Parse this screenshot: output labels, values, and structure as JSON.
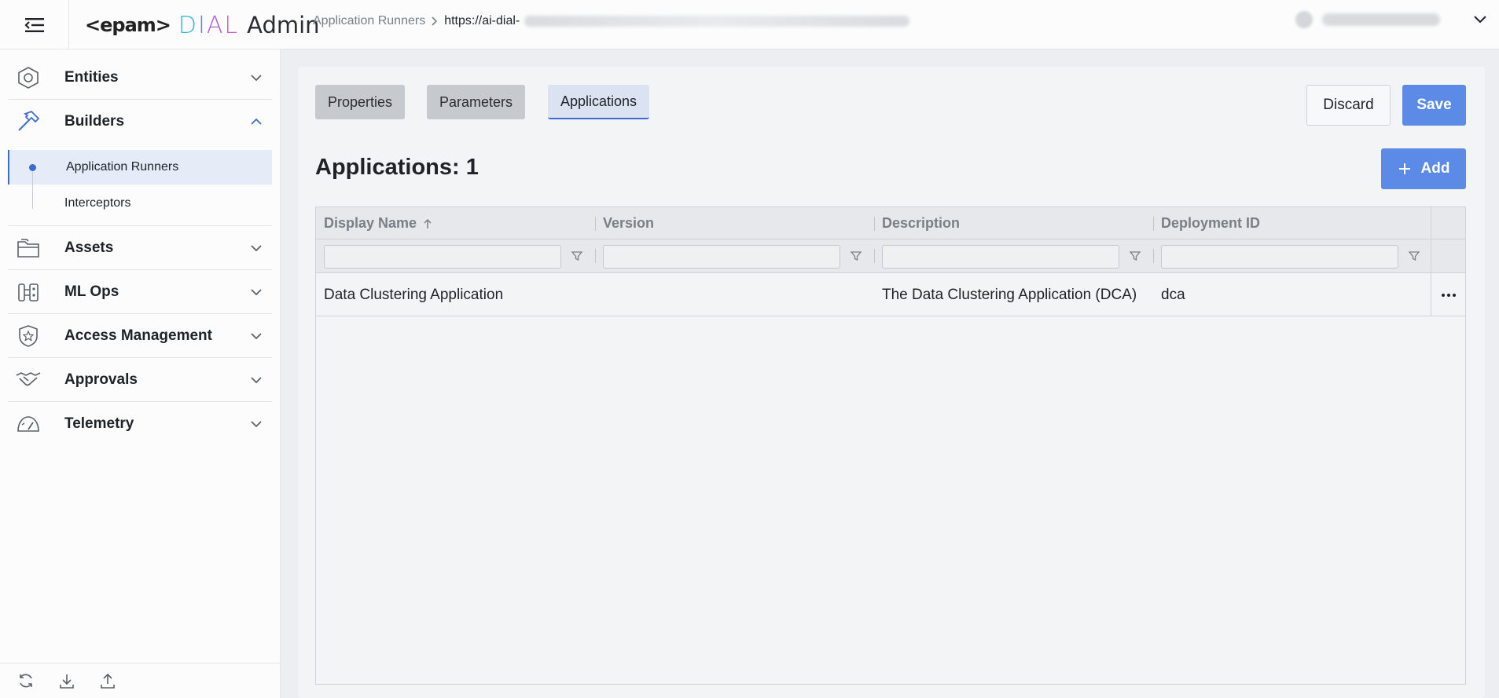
{
  "header": {
    "logo_epam": "<epam>",
    "logo_dial": [
      "D",
      "I",
      "A",
      "L"
    ],
    "logo_admin": "Admin",
    "breadcrumb": {
      "parent": "Application Runners",
      "current_url": "https://ai-dial-"
    }
  },
  "sidebar": {
    "items": [
      {
        "label": "Entities",
        "icon": "hexagon-icon"
      },
      {
        "label": "Builders",
        "icon": "hammer-icon",
        "expanded": true,
        "children": [
          {
            "label": "Application Runners",
            "active": true
          },
          {
            "label": "Interceptors"
          }
        ]
      },
      {
        "label": "Assets",
        "icon": "folder-icon"
      },
      {
        "label": "ML Ops",
        "icon": "mlops-icon"
      },
      {
        "label": "Access Management",
        "icon": "shield-star-icon"
      },
      {
        "label": "Approvals",
        "icon": "handshake-icon"
      },
      {
        "label": "Telemetry",
        "icon": "gauge-icon"
      }
    ],
    "footer_icons": [
      "refresh-icon",
      "download-icon",
      "upload-icon"
    ]
  },
  "main": {
    "tabs": [
      {
        "label": "Properties",
        "active": false
      },
      {
        "label": "Parameters",
        "active": false
      },
      {
        "label": "Applications",
        "active": true
      }
    ],
    "discard_label": "Discard",
    "save_label": "Save",
    "title": "Applications: 1",
    "add_label": "Add",
    "table": {
      "columns": [
        "Display Name",
        "Version",
        "Description",
        "Deployment ID"
      ],
      "sort": {
        "column": "Display Name",
        "direction": "asc"
      },
      "rows": [
        {
          "display_name": "Data Clustering Application",
          "version": "",
          "description": "The Data Clustering Application (DCA)",
          "deployment_id": "dca"
        }
      ]
    }
  },
  "colors": {
    "accent": "#5b8be6",
    "active_nav": "#e5ebf7",
    "active_marker": "#3d6bcf"
  }
}
